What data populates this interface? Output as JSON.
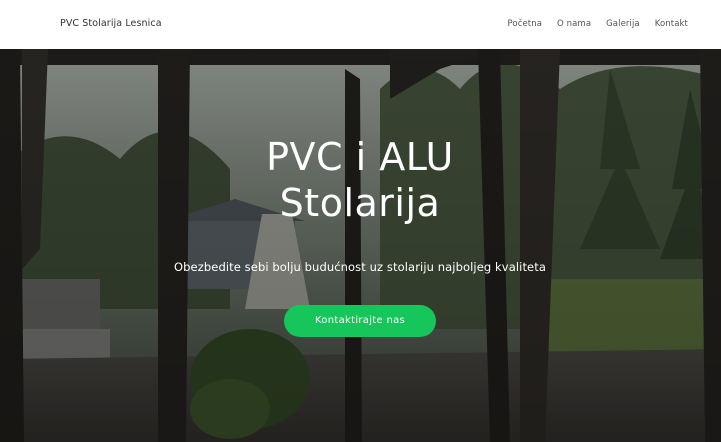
{
  "brand": "PVC Stolarija Lesnica",
  "nav": {
    "items": [
      {
        "label": "Početna"
      },
      {
        "label": "O nama"
      },
      {
        "label": "Galerija"
      },
      {
        "label": "Kontakt"
      }
    ]
  },
  "hero": {
    "title_line1": "PVC i ALU",
    "title_line2": "Stolarija",
    "subtitle": "Obezbedite sebi bolju budućnost uz stolariju najboljeg kvaliteta",
    "cta_label": "Kontaktirajte nas",
    "background_image": "pvc-window-terrace-photo"
  },
  "colors": {
    "accent": "#16c65a",
    "nav_bg": "#ffffff",
    "hero_text": "#ffffff"
  }
}
